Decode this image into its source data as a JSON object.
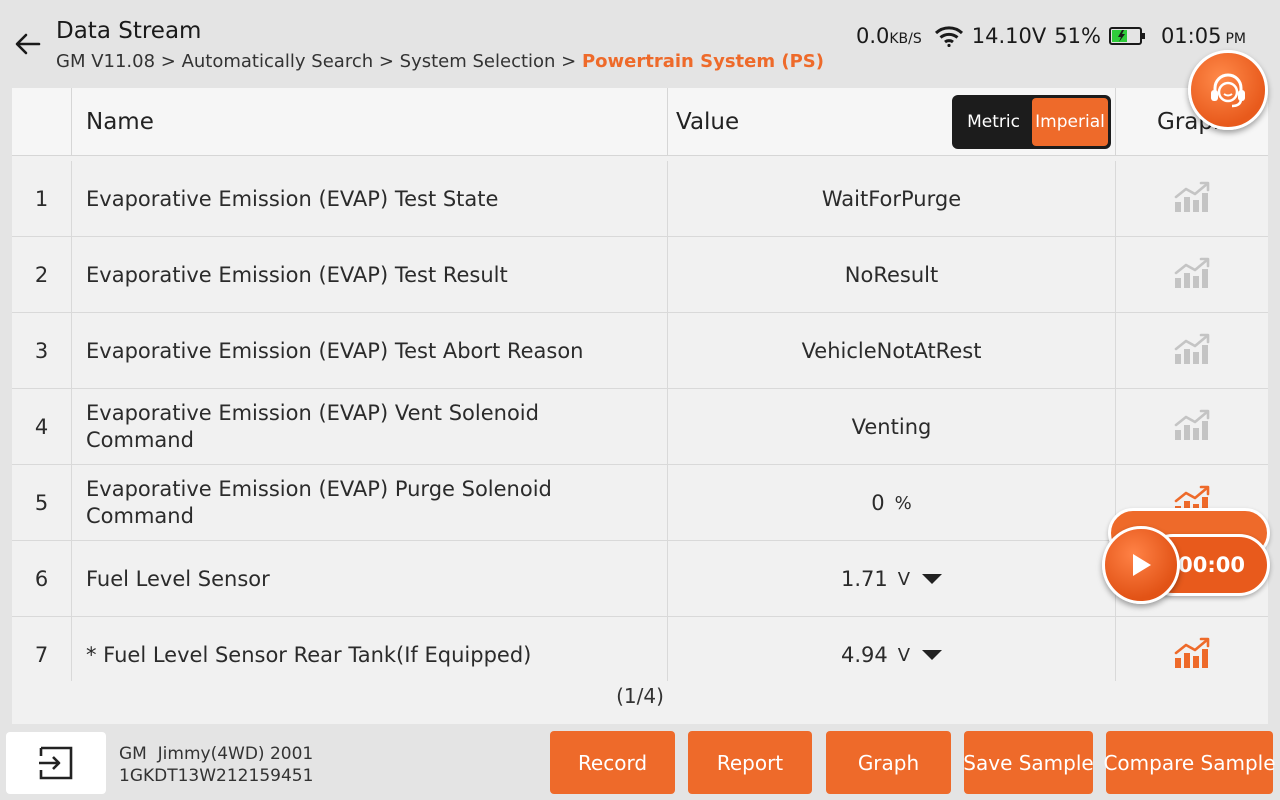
{
  "header": {
    "title": "Data Stream",
    "breadcrumb": {
      "path": "GM V11.08 > Automatically Search > System Selection > ",
      "current": "Powertrain System (PS)"
    }
  },
  "status": {
    "speed": "0.0",
    "speed_unit": "KB/S",
    "voltage": "14.10V",
    "battery_pct": "51%",
    "time": "01:05",
    "ampm": "PM"
  },
  "table": {
    "headers": {
      "name": "Name",
      "value": "Value",
      "graph": "Graph"
    },
    "unit_toggle": {
      "metric": "Metric",
      "imperial": "Imperial",
      "selected": "Imperial"
    },
    "rows": [
      {
        "num": "1",
        "name": "Evaporative Emission (EVAP) Test State",
        "value": "WaitForPurge",
        "unit": "",
        "dropdown": false,
        "graph_active": false
      },
      {
        "num": "2",
        "name": "Evaporative Emission (EVAP) Test Result",
        "value": "NoResult",
        "unit": "",
        "dropdown": false,
        "graph_active": false
      },
      {
        "num": "3",
        "name": "Evaporative Emission (EVAP) Test Abort Reason",
        "value": "VehicleNotAtRest",
        "unit": "",
        "dropdown": false,
        "graph_active": false
      },
      {
        "num": "4",
        "name": "Evaporative Emission (EVAP) Vent Solenoid Command",
        "value": "Venting",
        "unit": "",
        "dropdown": false,
        "graph_active": false
      },
      {
        "num": "5",
        "name": "Evaporative Emission (EVAP) Purge Solenoid Command",
        "value": "0",
        "unit": "%",
        "dropdown": false,
        "graph_active": true
      },
      {
        "num": "6",
        "name": "Fuel Level Sensor",
        "value": "1.71",
        "unit": "V",
        "dropdown": true,
        "graph_active": true
      },
      {
        "num": "7",
        "name": "* Fuel Level Sensor Rear Tank(If Equipped)",
        "value": "4.94",
        "unit": "V",
        "dropdown": true,
        "graph_active": true
      }
    ],
    "pager": "(1/4)"
  },
  "timer": {
    "elapsed": "00:00"
  },
  "vehicle": {
    "line1": "GM  Jimmy(4WD) 2001",
    "line2": "1GKDT13W212159451"
  },
  "actions": {
    "record": "Record",
    "report": "Report",
    "graph": "Graph",
    "save_sample": "Save Sample",
    "compare_sample": "Compare Sample"
  },
  "colors": {
    "accent": "#ee6a2a",
    "graph_inactive": "#c4c4c4",
    "graph_active": "#ee6a2a"
  }
}
